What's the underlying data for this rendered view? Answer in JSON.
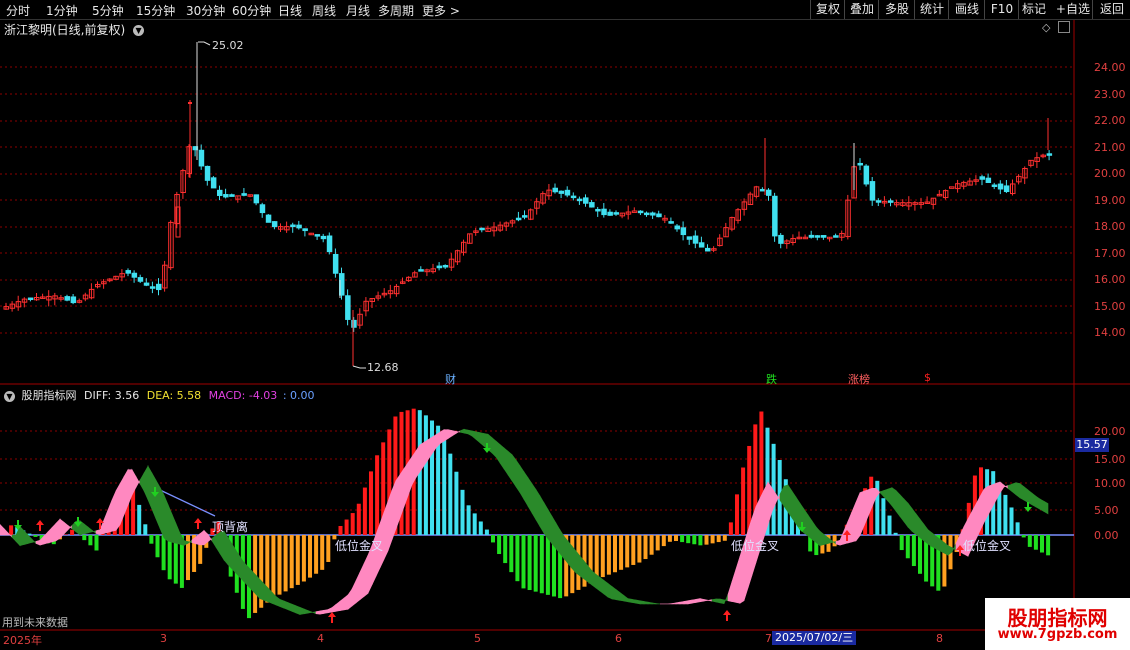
{
  "toolbar": {
    "left_items": [
      "分时",
      "1分钟",
      "5分钟",
      "15分钟",
      "30分钟",
      "60分钟",
      "日线",
      "周线",
      "月线",
      "多周期",
      "更多 >"
    ],
    "active": "日线",
    "right_items": [
      "复权",
      "叠加",
      "多股",
      "统计",
      "画线",
      "F10",
      "+自选",
      "返回"
    ]
  },
  "main_chart": {
    "title": "浙江黎明(日线,前复权)",
    "high_label": "25.02",
    "low_label": "12.68",
    "y_axis": [
      "24.00",
      "23.00",
      "22.00",
      "21.00",
      "20.00",
      "19.00",
      "18.00",
      "17.00",
      "16.00",
      "15.00",
      "14.00"
    ],
    "events": [
      {
        "label": "财",
        "color": "#6ab0ff"
      },
      {
        "label": "跌",
        "color": "#20e020"
      },
      {
        "label": "涨榜",
        "color": "#ff6060"
      },
      {
        "label": "$",
        "color": "#ff2020"
      }
    ]
  },
  "indicator": {
    "name": "股朋指标网",
    "diff_label": "DIFF: 3.56",
    "dea_label": "DEA: 5.58",
    "macd_label": "MACD: -4.03",
    "extra_label": ": 0.00",
    "current_value": "15.57",
    "y_axis": [
      "20.00",
      "15.00",
      "10.00",
      "5.00",
      "0.00"
    ],
    "annotations": [
      "顶背离",
      "低位金叉",
      "低位金叉",
      "低位金叉"
    ],
    "footer_note": "用到未来数据"
  },
  "x_axis": {
    "labels": [
      "2025年",
      "3",
      "4",
      "5",
      "6",
      "7",
      "8"
    ],
    "cursor_date": "2025/07/02/三"
  },
  "watermark": {
    "title": "股朋指标网",
    "url": "www.7gpzb.com"
  },
  "colors": {
    "up": "#ff3030",
    "down": "#40e0f0",
    "macd_pos_up": "#ff1a1a",
    "macd_pos_down": "#40e0f0",
    "macd_neg_down": "#20e020",
    "macd_neg_up": "#ffa020",
    "band_up": "#ff88c0",
    "band_down": "#2a8a2a",
    "grid": "#8b0000"
  }
}
